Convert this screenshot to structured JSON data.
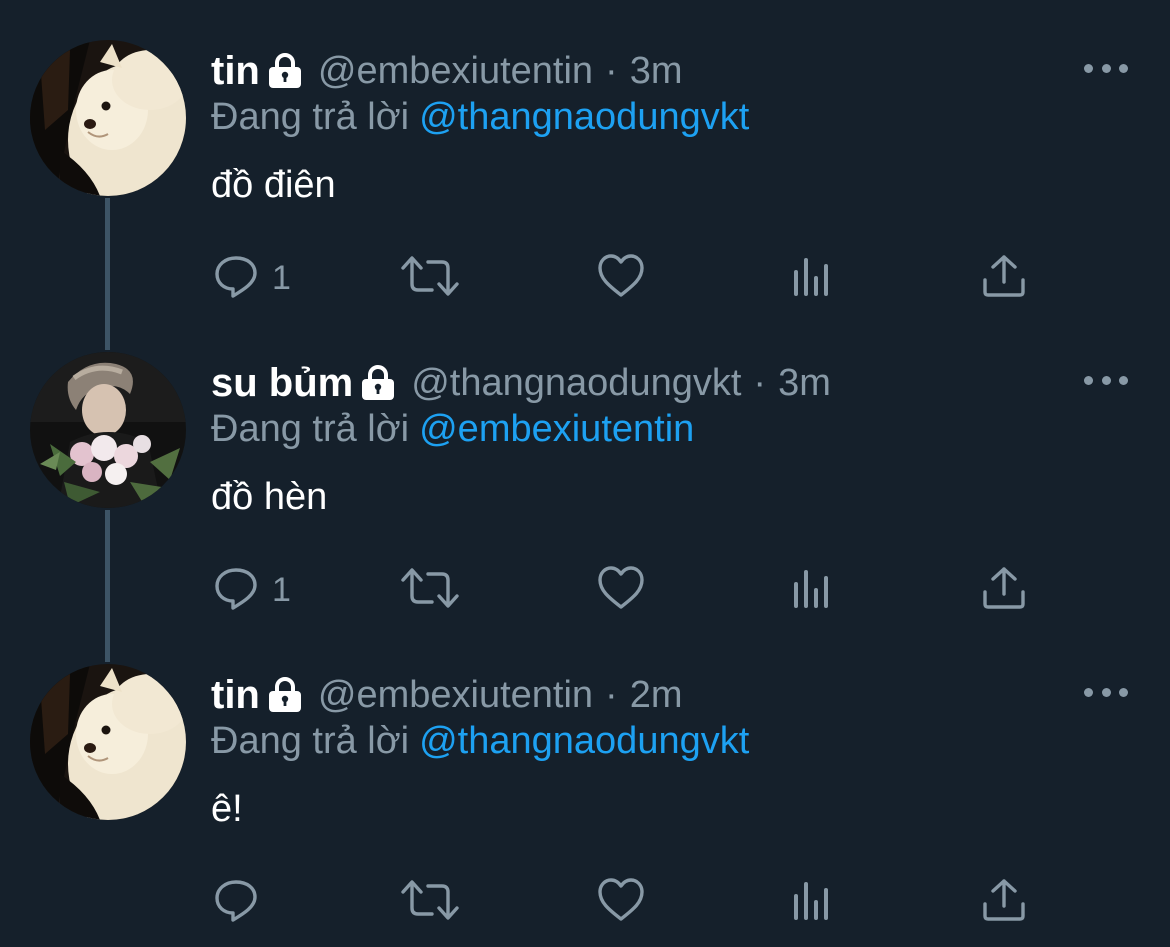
{
  "reply_prefix": "Đang trả lời",
  "colors": {
    "background": "#15202b",
    "secondary_text": "#8899a6",
    "link": "#1da1f2",
    "thread_line": "#3d5466"
  },
  "tweets": [
    {
      "name": "tin",
      "protected_icon": "lock-icon",
      "handle": "@embexiutentin",
      "separator": "·",
      "time": "3m",
      "reply_to": "@thangnaodungvkt",
      "text": "đồ điên",
      "reply_count": "1",
      "avatar": "white-pomeranian-dog"
    },
    {
      "name": "su bủm",
      "protected_icon": "lock-icon",
      "handle": "@thangnaodungvkt",
      "separator": "·",
      "time": "3m",
      "reply_to": "@embexiutentin",
      "text": "đồ hèn",
      "reply_count": "1",
      "avatar": "person-holding-flowers"
    },
    {
      "name": "tin",
      "protected_icon": "lock-icon",
      "handle": "@embexiutentin",
      "separator": "·",
      "time": "2m",
      "reply_to": "@thangnaodungvkt",
      "text": "ê!",
      "reply_count": "",
      "avatar": "white-pomeranian-dog"
    }
  ],
  "action_icons": [
    "reply-icon",
    "retweet-icon",
    "like-icon",
    "analytics-icon",
    "share-icon"
  ]
}
